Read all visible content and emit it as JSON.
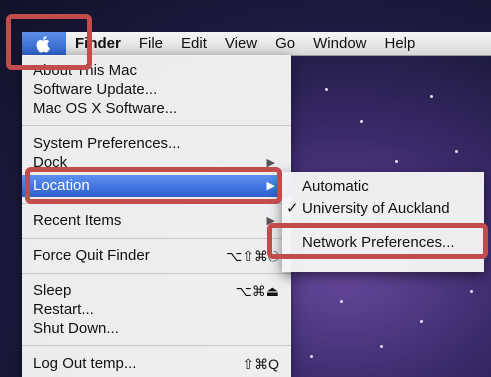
{
  "menubar": {
    "apple_icon": "apple-icon",
    "app_name": "Finder",
    "items": [
      "File",
      "Edit",
      "View",
      "Go",
      "Window",
      "Help"
    ]
  },
  "apple_menu": {
    "about": "About This Mac",
    "software_update": "Software Update...",
    "mac_os_x_software": "Mac OS X Software...",
    "system_preferences": "System Preferences...",
    "dock": "Dock",
    "location": "Location",
    "recent_items": "Recent Items",
    "force_quit": "Force Quit Finder",
    "force_quit_shortcut": "⌥⇧⌘⎋",
    "sleep": "Sleep",
    "sleep_shortcut": "⌥⌘⏏",
    "restart": "Restart...",
    "shut_down": "Shut Down...",
    "log_out": "Log Out temp...",
    "log_out_shortcut": "⇧⌘Q"
  },
  "location_submenu": {
    "automatic": "Automatic",
    "university": "University of Auckland",
    "checked_mark": "✓",
    "network_preferences": "Network Preferences..."
  },
  "colors": {
    "highlight": "#2d5fcf",
    "annotation": "#c24b4b"
  }
}
